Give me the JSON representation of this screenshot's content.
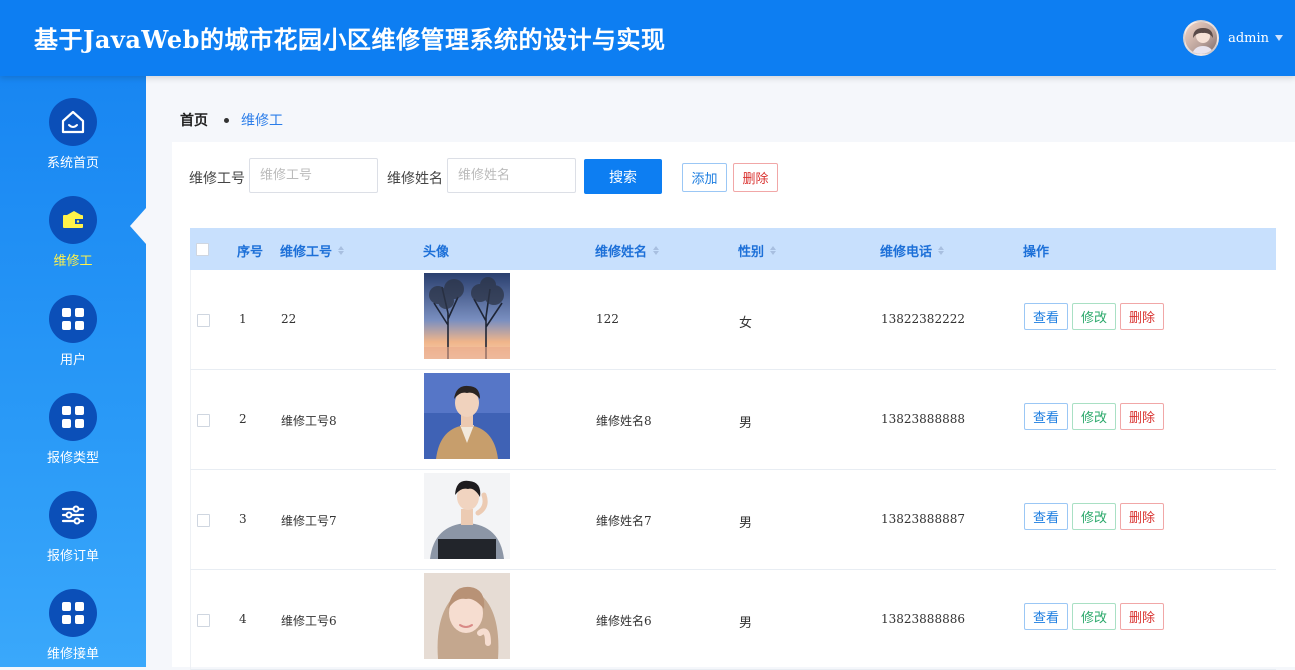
{
  "header": {
    "title": "基于JavaWeb的城市花园小区维修管理系统的设计与实现",
    "username": "admin"
  },
  "sidebar": {
    "items": [
      {
        "label": "系统首页",
        "icon": "home-icon"
      },
      {
        "label": "维修工",
        "icon": "wallet-icon",
        "active": true
      },
      {
        "label": "用户",
        "icon": "grid-icon"
      },
      {
        "label": "报修类型",
        "icon": "grid-icon"
      },
      {
        "label": "报修订单",
        "icon": "sliders-icon"
      },
      {
        "label": "维修接单",
        "icon": "grid-icon"
      }
    ]
  },
  "breadcrumb": {
    "home": "首页",
    "current": "维修工"
  },
  "search": {
    "worker_id_label": "维修工号",
    "worker_id_placeholder": "维修工号",
    "worker_name_label": "维修姓名",
    "worker_name_placeholder": "维修姓名",
    "search_button": "搜索",
    "add_button": "添加",
    "delete_button": "删除"
  },
  "table": {
    "columns": [
      "序号",
      "维修工号",
      "头像",
      "维修姓名",
      "性别",
      "维修电话",
      "操作"
    ],
    "actions": {
      "view": "查看",
      "edit": "修改",
      "delete": "删除"
    },
    "rows": [
      {
        "index": "1",
        "worker_id": "22",
        "name": "122",
        "gender": "女",
        "phone": "13822382222",
        "photo": "trees-photo"
      },
      {
        "index": "2",
        "worker_id": "维修工号8",
        "name": "维修姓名8",
        "gender": "男",
        "phone": "13823888888",
        "photo": "person-photo"
      },
      {
        "index": "3",
        "worker_id": "维修工号7",
        "name": "维修姓名7",
        "gender": "男",
        "phone": "13823888887",
        "photo": "person-photo"
      },
      {
        "index": "4",
        "worker_id": "维修工号6",
        "name": "维修姓名6",
        "gender": "男",
        "phone": "13823888886",
        "photo": "person-photo"
      }
    ]
  },
  "colors": {
    "primary": "#0d7ef2",
    "header_bg": "#0d7ef2",
    "sidebar_active": "#fff34a",
    "table_header_bg": "#c8e0fd",
    "danger": "#d9312e",
    "success": "#2aa86a"
  }
}
